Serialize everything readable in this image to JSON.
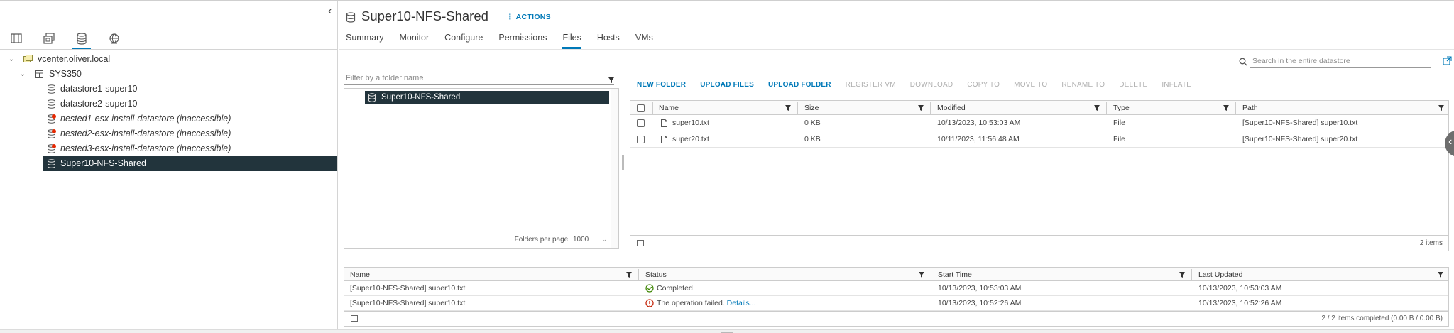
{
  "navigator": {
    "tabs": [
      {
        "icon": "hosts-clusters-icon"
      },
      {
        "icon": "vms-templates-icon"
      },
      {
        "icon": "storage-icon"
      },
      {
        "icon": "networking-icon"
      }
    ],
    "tree": {
      "vcenter": "vcenter.oliver.local",
      "datacenter": "SYS350",
      "datastores": [
        {
          "label": "datastore1-super10",
          "state": "normal"
        },
        {
          "label": "datastore2-super10",
          "state": "normal"
        },
        {
          "label": "nested1-esx-install-datastore (inaccessible)",
          "state": "error"
        },
        {
          "label": "nested2-esx-install-datastore (inaccessible)",
          "state": "error"
        },
        {
          "label": "nested3-esx-install-datastore (inaccessible)",
          "state": "error"
        },
        {
          "label": "Super10-NFS-Shared",
          "state": "selected"
        }
      ]
    }
  },
  "header": {
    "title": "Super10-NFS-Shared",
    "actions_label": "ACTIONS"
  },
  "tabs": [
    {
      "label": "Summary",
      "active": false
    },
    {
      "label": "Monitor",
      "active": false
    },
    {
      "label": "Configure",
      "active": false
    },
    {
      "label": "Permissions",
      "active": false
    },
    {
      "label": "Files",
      "active": true
    },
    {
      "label": "Hosts",
      "active": false
    },
    {
      "label": "VMs",
      "active": false
    }
  ],
  "search": {
    "placeholder": "Search in the entire datastore"
  },
  "folders": {
    "filter_placeholder": "Filter by a folder name",
    "selected_folder": "Super10-NFS-Shared",
    "per_page_label": "Folders per page",
    "per_page_value": "1000"
  },
  "toolbar": {
    "new_folder": "NEW FOLDER",
    "upload_files": "UPLOAD FILES",
    "upload_folder": "UPLOAD FOLDER",
    "register_vm": "REGISTER VM",
    "download": "DOWNLOAD",
    "copy_to": "COPY TO",
    "move_to": "MOVE TO",
    "rename_to": "RENAME TO",
    "delete": "DELETE",
    "inflate": "INFLATE"
  },
  "files": {
    "columns": {
      "name": "Name",
      "size": "Size",
      "modified": "Modified",
      "type": "Type",
      "path": "Path"
    },
    "rows": [
      {
        "name": "super10.txt",
        "size": "0 KB",
        "modified": "10/13/2023, 10:53:03 AM",
        "type": "File",
        "path": "[Super10-NFS-Shared] super10.txt"
      },
      {
        "name": "super20.txt",
        "size": "0 KB",
        "modified": "10/11/2023, 11:56:48 AM",
        "type": "File",
        "path": "[Super10-NFS-Shared] super20.txt"
      }
    ],
    "count_label": "2 items"
  },
  "tasks": {
    "columns": {
      "name": "Name",
      "status": "Status",
      "start": "Start Time",
      "updated": "Last Updated"
    },
    "rows": [
      {
        "name": "[Super10-NFS-Shared] super10.txt",
        "status": "Completed",
        "status_kind": "success",
        "details": "",
        "start": "10/13/2023, 10:53:03 AM",
        "updated": "10/13/2023, 10:53:03 AM"
      },
      {
        "name": "[Super10-NFS-Shared] super10.txt",
        "status": "The operation failed.",
        "status_kind": "error",
        "details": "Details...",
        "start": "10/13/2023, 10:52:26 AM",
        "updated": "10/13/2023, 10:52:26 AM"
      }
    ],
    "summary_label": "2 / 2 items completed (0.00 B / 0.00 B)"
  },
  "colors": {
    "accent": "#0079b8",
    "selection": "#22343c",
    "success": "#3c8500",
    "error": "#c21d00"
  }
}
